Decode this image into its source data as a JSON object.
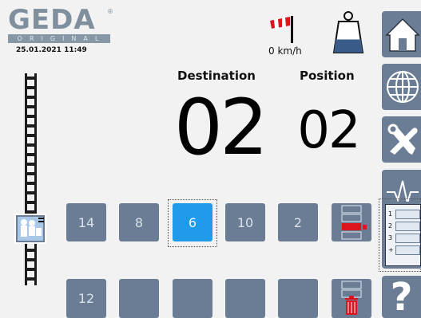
{
  "logo": {
    "word": "GEDA",
    "registered": "®",
    "subtitle": "ORIGINAL"
  },
  "status": {
    "datetime": "25.01.2021  11:49",
    "wind_speed": "0 km/h"
  },
  "display": {
    "destination_label": "Destination",
    "position_label": "Position",
    "destination_value": "02",
    "position_value": "02"
  },
  "floors": {
    "row1": [
      "14",
      "8",
      "6",
      "10",
      "2"
    ],
    "row2": [
      "12",
      "",
      "",
      "",
      ""
    ],
    "selected": "6"
  },
  "side_menu": {
    "items": [
      "home-icon",
      "globe-icon",
      "tools-icon",
      "pulse-icon",
      "queue-list-icon",
      "help-icon"
    ],
    "queue_numbers": [
      "1",
      "2",
      "3",
      "+"
    ],
    "help_glyph": "?"
  },
  "colors": {
    "button": "#6a7d95",
    "selected": "#1f9bea",
    "alert_red": "#e0141e",
    "background": "#f2f2f2"
  }
}
